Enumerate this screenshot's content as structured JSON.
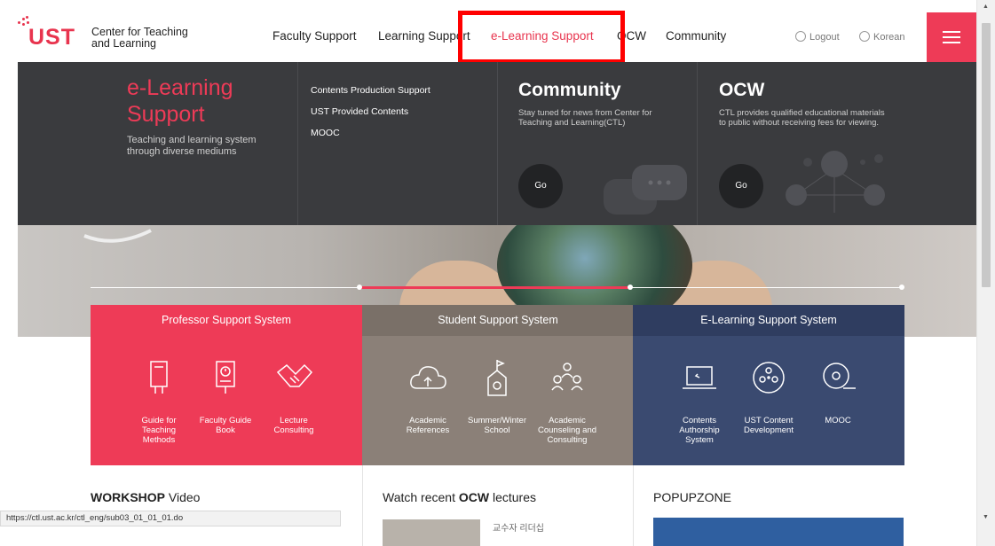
{
  "header": {
    "logo": "UST",
    "site_name": "Center for Teaching and Learning",
    "nav": [
      "Faculty Support",
      "Learning Support",
      "e-Learning Support",
      "OCW",
      "Community"
    ],
    "logout": "Logout",
    "language": "Korean",
    "accent_color": "#ee3b57"
  },
  "mega_menu": {
    "title": "e-Learning Support",
    "desc": "Teaching and learning system through diverse mediums",
    "links": [
      "Contents Production Support",
      "UST Provided Contents",
      "MOOC"
    ],
    "community": {
      "title": "Community",
      "desc": "Stay tuned for news from Center for Teaching and Learning(CTL)",
      "go": "Go"
    },
    "ocw": {
      "title": "OCW",
      "desc": "CTL provides qualified educational materials to public without receiving fees for viewing.",
      "go": "Go"
    }
  },
  "support_systems": [
    {
      "title": "Professor Support System",
      "color": "#ee3b57",
      "items": [
        "Guide for Teaching Methods",
        "Faculty Guide Book",
        "Lecture Consulting"
      ]
    },
    {
      "title": "Student Support System",
      "color": "#8b8078",
      "items": [
        "Academic References",
        "Summer/Winter School",
        "Academic Counseling and Consulting"
      ]
    },
    {
      "title": "E-Learning Support System",
      "color": "#3a4a70",
      "items": [
        "Contents Authorship System",
        "UST Content Development",
        "MOOC"
      ]
    }
  ],
  "bottom": {
    "workshop_bold": "WORKSHOP",
    "workshop_rest": " Video",
    "ocw_pre": "Watch recent ",
    "ocw_bold": "OCW",
    "ocw_post": " lectures",
    "ocw_item": "교수자 리더십",
    "popupzone": "POPUPZONE"
  },
  "status_bar": {
    "url": "https://ctl.ust.ac.kr/ctl_eng/sub03_01_01_01.do"
  }
}
